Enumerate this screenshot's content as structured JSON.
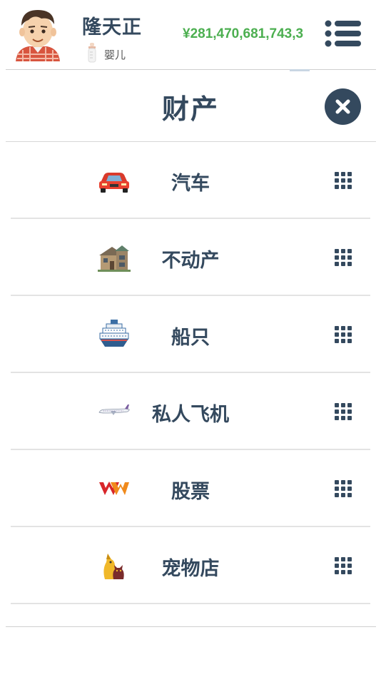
{
  "header": {
    "name": "隆天正",
    "age_label": "婴儿",
    "money": "¥281,470,681,743,3",
    "avatar_icon": "boy-avatar-icon",
    "age_icon": "baby-bottle-icon",
    "menu_icon": "list-menu-icon"
  },
  "page": {
    "title": "财产",
    "close_icon": "close-icon"
  },
  "assets": [
    {
      "label": "汽车",
      "icon": "car-icon"
    },
    {
      "label": "不动产",
      "icon": "house-icon"
    },
    {
      "label": "船只",
      "icon": "ship-icon"
    },
    {
      "label": "私人飞机",
      "icon": "airplane-icon"
    },
    {
      "label": "股票",
      "icon": "stock-logo-icon"
    },
    {
      "label": "宠物店",
      "icon": "pet-shop-icon"
    }
  ],
  "colors": {
    "primary": "#34495e",
    "money": "#4caf50",
    "divider": "#e3e3e3"
  }
}
